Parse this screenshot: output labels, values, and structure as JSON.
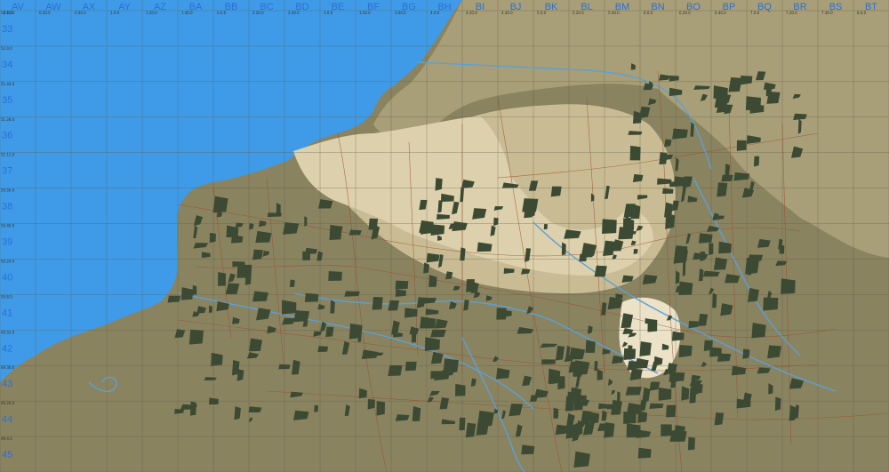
{
  "map": {
    "colors": {
      "sea": "#3f9be8",
      "land_dark": "#8a8360",
      "land_mid": "#a89f78",
      "land_light": "#c9bc94",
      "land_pale": "#ddd0ac",
      "land_white": "#ebe2c8",
      "forest": "#3c4a34",
      "grid": "#5c5a44",
      "road": "#9b4a2a",
      "river": "#5aa0d8",
      "label": "#2a6fd6"
    },
    "column_labels": [
      "AV",
      "AW",
      "AX",
      "AY",
      "AZ",
      "BA",
      "BB",
      "BC",
      "BD",
      "BE",
      "BF",
      "BG",
      "BH",
      "BI",
      "BJ",
      "BK",
      "BL",
      "BM",
      "BN",
      "BO",
      "BP",
      "BQ",
      "BR",
      "BS",
      "BT"
    ],
    "column_coords": [
      "0.0.0",
      "0.20.0",
      "0.40.0",
      "1.0.0",
      "1.20.0",
      "1.40.0",
      "2.0.0",
      "2.20.0",
      "2.40.0",
      "3.0.0",
      "3.20.0",
      "3.40.0",
      "4.0.0",
      "4.20.0",
      "4.40.0",
      "5.0.0",
      "5.20.0",
      "5.40.0",
      "6.0.0",
      "6.20.0",
      "6.40.0",
      "7.0.0",
      "7.20.0",
      "7.40.0",
      "8.0.0"
    ],
    "row_labels": [
      "33",
      "34",
      "35",
      "36",
      "37",
      "38",
      "39",
      "40",
      "41",
      "42",
      "43",
      "44",
      "45"
    ],
    "row_coords": [
      "52.10.0",
      "52.0.0",
      "51.44.0",
      "51.28.0",
      "51.12.0",
      "50.56.0",
      "50.40.0",
      "50.24.0",
      "50.8.0",
      "49.52.0",
      "49.36.0",
      "49.20.0",
      "49.4.0"
    ]
  }
}
